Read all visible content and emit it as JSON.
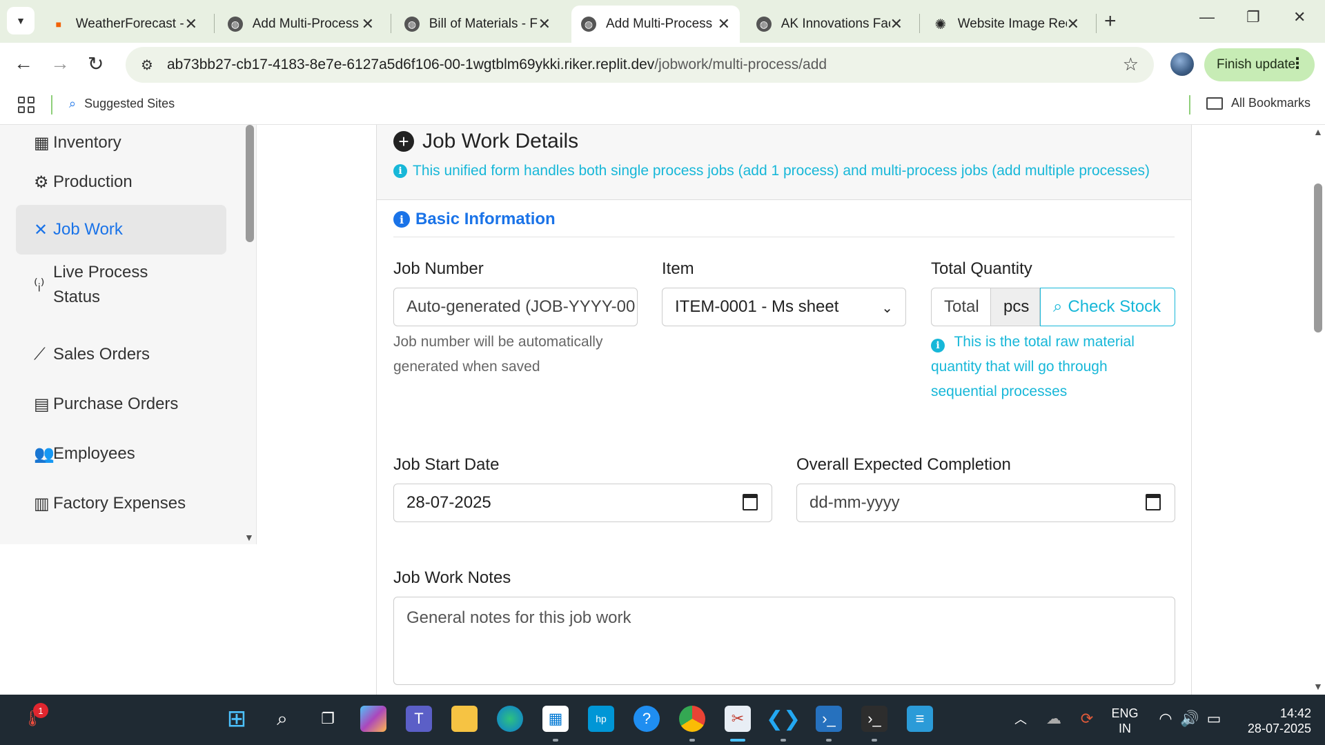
{
  "browser": {
    "tabs": [
      {
        "label": "WeatherForecast -",
        "icon": "replit-icon",
        "active": false
      },
      {
        "label": "Add Multi-Process",
        "icon": "globe-icon",
        "active": false
      },
      {
        "label": "Bill of Materials - F",
        "icon": "globe-icon",
        "active": false
      },
      {
        "label": "Add Multi-Process",
        "icon": "globe-icon",
        "active": true
      },
      {
        "label": "AK Innovations Fac",
        "icon": "globe-icon",
        "active": false
      },
      {
        "label": "Website Image Rec",
        "icon": "openai-icon",
        "active": false
      }
    ],
    "url_host": "ab73bb27-cb17-4183-8e7e-6127a5d6f106-00-1wgtblm69ykki.riker.replit.dev",
    "url_path": "/jobwork/multi-process/add",
    "finish_update": "Finish update",
    "suggested_sites": "Suggested Sites",
    "all_bookmarks": "All Bookmarks"
  },
  "sidebar": {
    "items": [
      {
        "label": "Inventory",
        "icon": "boxes-icon"
      },
      {
        "label": "Production",
        "icon": "gears-icon"
      },
      {
        "label": "Job Work",
        "icon": "tools-icon",
        "active": true
      },
      {
        "label": "Live Process Status",
        "icon": "broadcast-icon"
      },
      {
        "label": "Sales Orders",
        "icon": "chart-line-icon"
      },
      {
        "label": "Purchase Orders",
        "icon": "file-icon"
      },
      {
        "label": "Employees",
        "icon": "users-icon"
      },
      {
        "label": "Factory Expenses",
        "icon": "receipt-icon"
      }
    ]
  },
  "form": {
    "title": "Job Work Details",
    "info": "This unified form handles both single process jobs (add 1 process) and multi-process jobs (add multiple processes)",
    "section": "Basic Information",
    "job_number": {
      "label": "Job Number",
      "value": "Auto-generated (JOB-YYYY-00",
      "help": "Job number will be automatically generated when saved"
    },
    "item": {
      "label": "Item",
      "value": "ITEM-0001 - Ms sheet"
    },
    "total_quantity": {
      "label": "Total Quantity",
      "placeholder": "Total",
      "unit": "pcs",
      "button": "Check Stock",
      "help": "This is the total raw material quantity that will go through sequential processes"
    },
    "start_date": {
      "label": "Job Start Date",
      "value": "28-07-2025"
    },
    "completion": {
      "label": "Overall Expected Completion",
      "placeholder": "dd-mm-yyyy"
    },
    "notes": {
      "label": "Job Work Notes",
      "placeholder": "General notes for this job work"
    }
  },
  "taskbar": {
    "notification_count": "1",
    "lang": "ENG",
    "region": "IN",
    "time": "14:42",
    "date": "28-07-2025"
  }
}
